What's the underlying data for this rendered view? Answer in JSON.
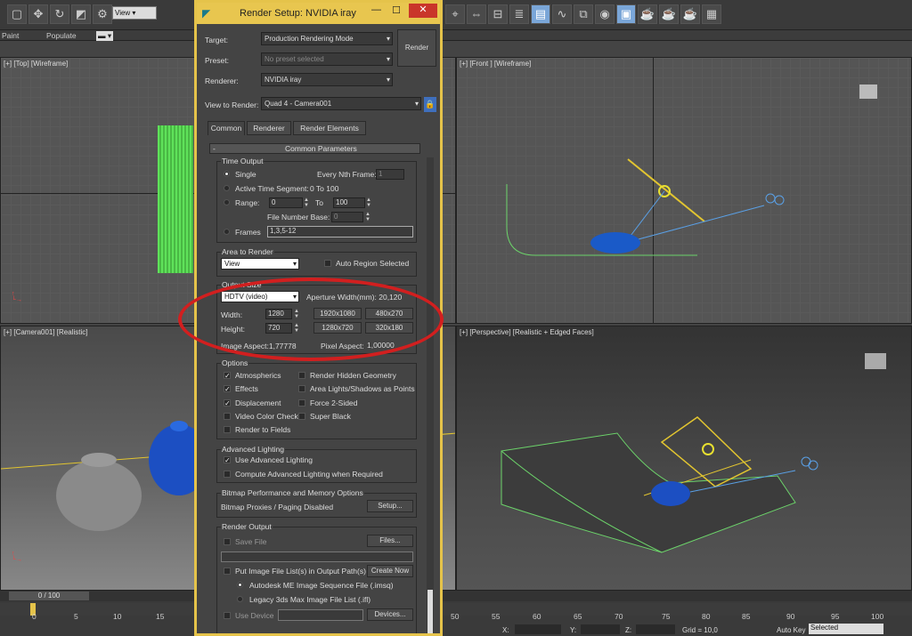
{
  "toolbar": {
    "view_label": "View",
    "paint_label": "Paint",
    "populate_label": "Populate"
  },
  "viewports": {
    "top": "[+] [Top] [Wireframe]",
    "front": "[+] [Front ] [Wireframe]",
    "camera": "[+] [Camera001] [Realistic]",
    "perspective": "[+] [Perspective] [Realistic + Edged Faces]"
  },
  "dialog": {
    "title": "Render Setup: NVIDIA iray",
    "target_label": "Target:",
    "target_value": "Production Rendering Mode",
    "render_button": "Render",
    "preset_label": "Preset:",
    "preset_value": "No preset selected",
    "renderer_label": "Renderer:",
    "renderer_value": "NVIDIA iray",
    "view_label": "View to Render:",
    "view_value": "Quad 4 - Camera001",
    "tabs": [
      "Common",
      "Renderer",
      "Render Elements"
    ],
    "rollout_title": "Common Parameters",
    "time_output": {
      "title": "Time Output",
      "single": "Single",
      "every_nth": "Every Nth Frame:",
      "every_nth_value": "1",
      "active_segment": "Active Time Segment:",
      "active_range": "0 To 100",
      "range": "Range:",
      "range_from": "0",
      "to": "To",
      "range_to": "100",
      "file_number_base": "File Number Base:",
      "file_number_value": "0",
      "frames": "Frames",
      "frames_value": "1,3,5-12"
    },
    "area": {
      "title": "Area to Render",
      "value": "View",
      "auto_region": "Auto Region Selected"
    },
    "output_size": {
      "title": "Output Size",
      "preset": "HDTV (video)",
      "aperture": "Aperture Width(mm): 20,120",
      "width_label": "Width:",
      "width": "1280",
      "height_label": "Height:",
      "height": "720",
      "presets": [
        "1920x1080",
        "480x270",
        "1280x720",
        "320x180"
      ],
      "image_aspect": "Image Aspect:1,77778",
      "pixel_aspect_label": "Pixel Aspect:",
      "pixel_aspect": "1,00000"
    },
    "options": {
      "title": "Options",
      "atmospherics": "Atmospherics",
      "render_hidden": "Render Hidden Geometry",
      "effects": "Effects",
      "area_lights": "Area Lights/Shadows as Points",
      "displacement": "Displacement",
      "force_2sided": "Force 2-Sided",
      "video_color": "Video Color Check",
      "super_black": "Super Black",
      "render_to_fields": "Render to Fields"
    },
    "advanced_lighting": {
      "title": "Advanced Lighting",
      "use": "Use Advanced Lighting",
      "compute": "Compute Advanced Lighting when Required"
    },
    "bitmap": {
      "title": "Bitmap Performance and Memory Options",
      "status": "Bitmap Proxies / Paging Disabled",
      "setup": "Setup..."
    },
    "render_output": {
      "title": "Render Output",
      "save_file": "Save File",
      "files": "Files...",
      "put_image": "Put Image File List(s) in Output Path(s)",
      "create_now": "Create Now",
      "autodesk": "Autodesk ME Image Sequence File (.imsq)",
      "legacy": "Legacy 3ds Max Image File List (.ifl)",
      "use_device": "Use Device",
      "devices": "Devices..."
    }
  },
  "timeline": {
    "frame": "0 / 100",
    "ticks": [
      "0",
      "5",
      "10",
      "15",
      "50",
      "55",
      "60",
      "65",
      "70",
      "75",
      "80",
      "85",
      "90",
      "95",
      "100"
    ]
  },
  "status": {
    "x": "X:",
    "y": "Y:",
    "z": "Z:",
    "grid": "Grid = 10,0",
    "autokey": "Auto Key",
    "selected": "Selected"
  }
}
